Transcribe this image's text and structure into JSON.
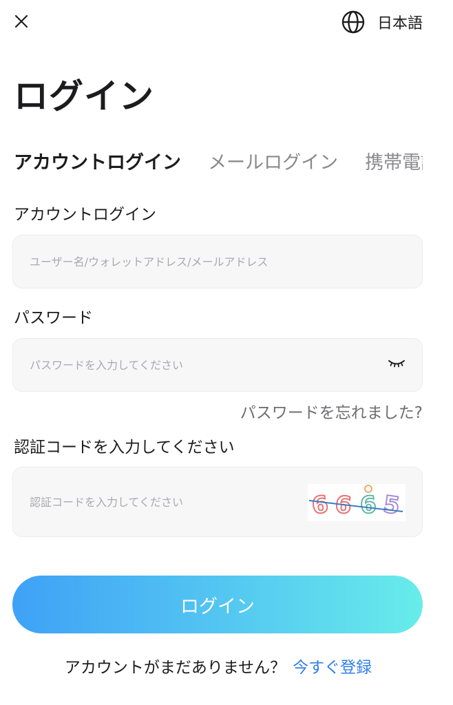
{
  "header": {
    "close_icon": "close-icon",
    "language_icon": "globe-icon",
    "language_label": "日本語"
  },
  "title": "ログイン",
  "tabs": [
    {
      "label": "アカウントログイン",
      "active": true
    },
    {
      "label": "メールログイン",
      "active": false
    },
    {
      "label": "携帯電話",
      "active": false
    }
  ],
  "account_field": {
    "label": "アカウントログイン",
    "placeholder": "ユーザー名/ウォレットアドレス/メールアドレス",
    "value": ""
  },
  "password_field": {
    "label": "パスワード",
    "placeholder": "パスワードを入力してください",
    "value": "",
    "toggle_icon": "eye-closed-icon"
  },
  "forgot_password": "パスワードを忘れました?",
  "captcha_field": {
    "label": "認証コードを入力してください",
    "placeholder": "認証コードを入力してください",
    "value": "",
    "captcha_code": [
      "6",
      "6",
      "6",
      "5"
    ]
  },
  "login_button": "ログイン",
  "signup": {
    "prompt": "アカウントがまだありません？",
    "link": "今すぐ登録"
  },
  "colors": {
    "link": "#2f7fe8",
    "button_gradient_start": "#3fa1f6",
    "button_gradient_end": "#68ecea",
    "field_background": "#f7f7f8"
  }
}
